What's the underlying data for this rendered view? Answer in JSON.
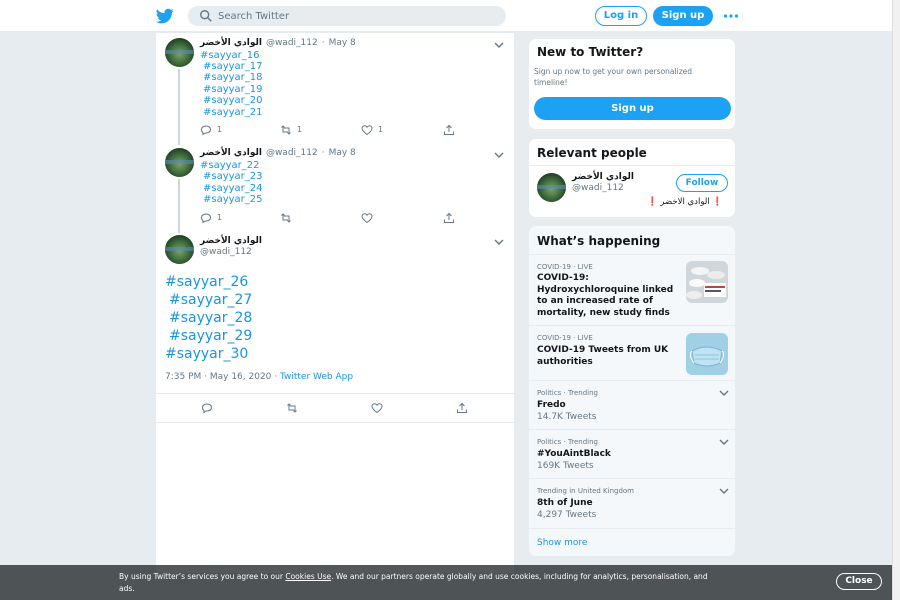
{
  "header": {
    "search_placeholder": "Search Twitter",
    "login_label": "Log in",
    "signup_label": "Sign up"
  },
  "tweets": [
    {
      "name": "الوادي الأخضر",
      "handle": "@wadi_112",
      "date": "May 8",
      "tags": [
        "#sayyar_16",
        "#sayyar_17",
        "#sayyar_18",
        "#sayyar_19",
        "#sayyar_20",
        "#sayyar_21"
      ],
      "reply_count": "1",
      "retweet_count": "1",
      "like_count": "1"
    },
    {
      "name": "الوادي الأخضر",
      "handle": "@wadi_112",
      "date": "May 8",
      "tags": [
        "#sayyar_22",
        "#sayyar_23",
        "#sayyar_24",
        "#sayyar_25"
      ]
    }
  ],
  "main_tweet": {
    "name": "الوادي الأخضر",
    "handle": "@wadi_112",
    "tags": [
      "#sayyar_26",
      "#sayyar_27",
      "#sayyar_28",
      "#sayyar_29",
      "#sayyar_30"
    ],
    "timestamp": "7:35 PM · May 16, 2020 · ",
    "source": "Twitter Web App"
  },
  "new_to_twitter": {
    "title": "New to Twitter?",
    "subtitle": "Sign up now to get your own personalized timeline!",
    "signup_label": "Sign up"
  },
  "relevant_people": {
    "title": "Relevant people",
    "name": "الوادي الأخضر",
    "handle": "@wadi_112",
    "follow_label": "Follow",
    "bio": "❗ الوادي الاخضر ❗"
  },
  "whats_happening": {
    "title": "What’s happening",
    "trends": [
      {
        "meta": "COVID-19 · LIVE",
        "title": "COVID-19: Hydroxychloroquine linked to an increased rate of mortality, new study finds",
        "count": "",
        "image": "pills-image"
      },
      {
        "meta": "COVID-19 · LIVE",
        "title": "COVID-19 Tweets from UK authorities",
        "count": "",
        "image": "mask-image"
      },
      {
        "meta": "Politics · Trending",
        "title": "Fredo",
        "count": "14.7K Tweets"
      },
      {
        "meta": "Politics · Trending",
        "title": "#YouAintBlack",
        "count": "169K Tweets"
      },
      {
        "meta": "Trending in United Kingdom",
        "title": "8th of June",
        "count": "4,297 Tweets"
      }
    ],
    "show_more": "Show more"
  },
  "cookie_banner": {
    "text_before": "By using Twitter’s services you agree to our ",
    "link": "Cookies Use",
    "text_after": ". We and our partners operate globally and use cookies, including for analytics, personalisation, and ads.",
    "close_label": "Close"
  },
  "colors": {
    "accent": "#1da1f2",
    "link": "#1b95e0",
    "background": "#e6ecf0"
  }
}
